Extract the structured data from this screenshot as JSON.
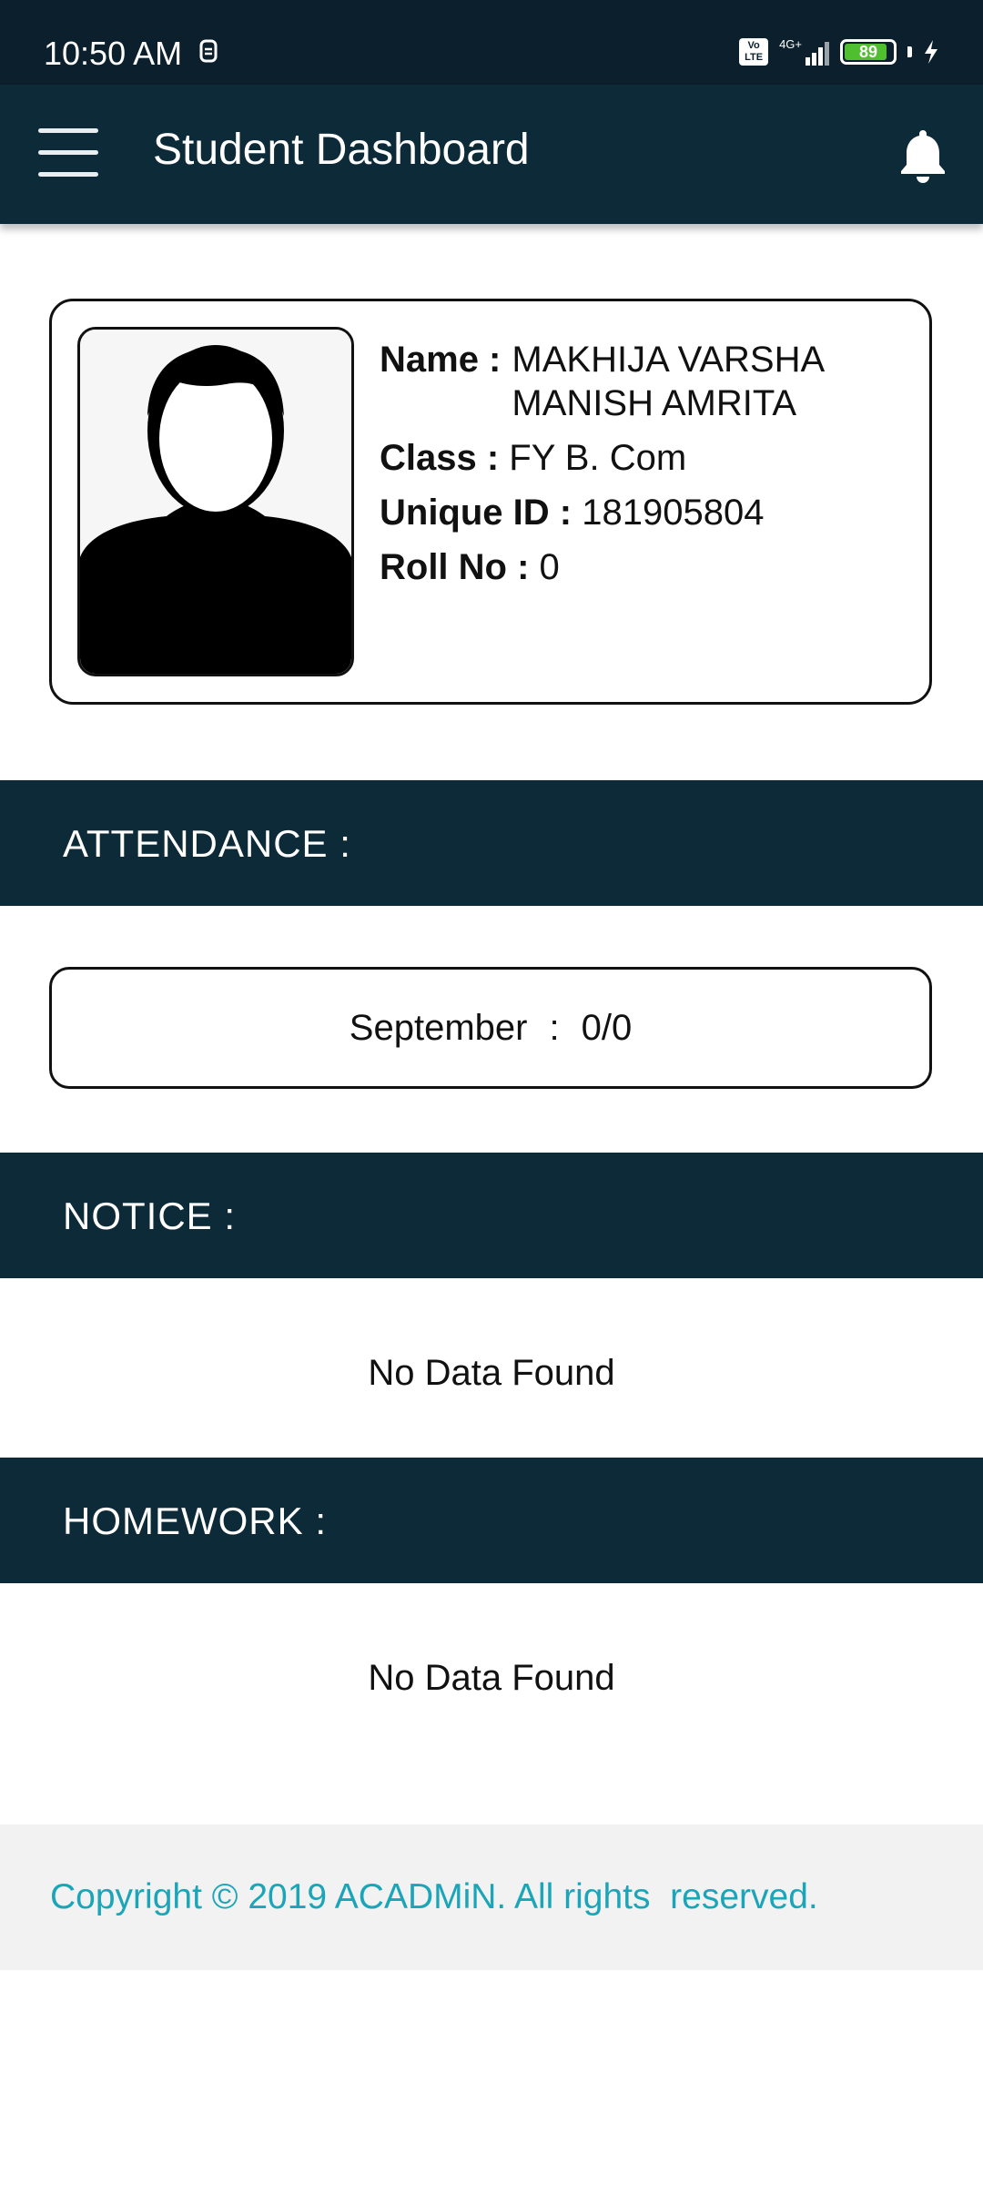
{
  "status_bar": {
    "time": "10:50 AM",
    "volte": "Vo LTE",
    "network": "4G+",
    "battery": "89",
    "battery_level": 0.89
  },
  "appbar": {
    "title": "Student Dashboard",
    "menu_icon": "hamburger-menu-icon",
    "bell_icon": "bell-icon"
  },
  "profile": {
    "name_label": "Name :",
    "name_value": "MAKHIJA VARSHA MANISH AMRITA",
    "class_label": "Class :",
    "class_value": "FY B. Com",
    "uid_label": "Unique ID :",
    "uid_value": "181905804",
    "roll_label": "Roll No :",
    "roll_value": "0"
  },
  "sections": {
    "attendance": "ATTENDANCE :",
    "notice": "NOTICE :",
    "homework": "HOMEWORK :"
  },
  "attendance": {
    "month": "September",
    "separator": ":",
    "value": "0/0"
  },
  "notice": {
    "empty_text": "No Data Found"
  },
  "homework": {
    "empty_text": "No Data Found"
  },
  "footer": {
    "copyright": "Copyright © 2019 ACADMiN. All rights  reserved."
  },
  "colors": {
    "primary": "#0d2a38",
    "statusbar": "#0b1f2c",
    "footer_text": "#1aa5b8",
    "footer_bg": "#f2f2f2",
    "battery": "#4fbf2f"
  }
}
